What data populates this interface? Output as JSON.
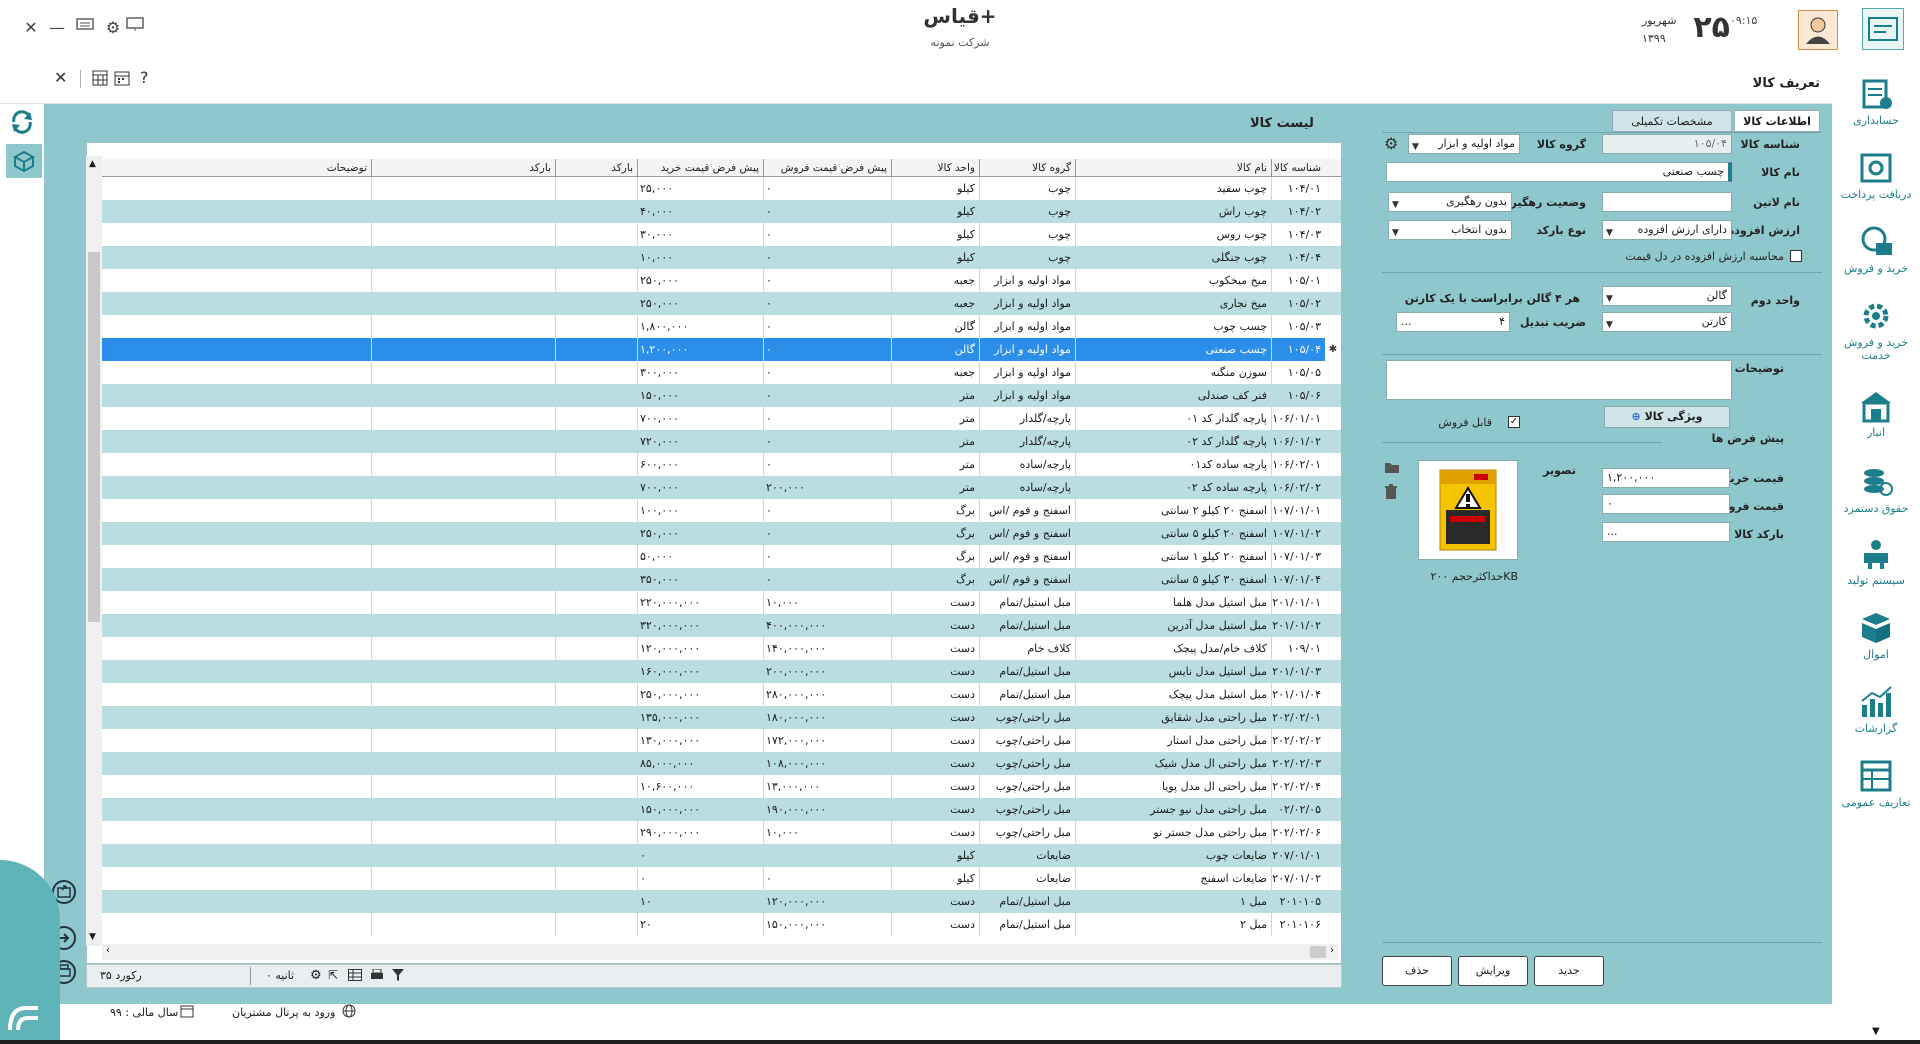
{
  "app": {
    "title": "قیاس+",
    "company": "شرکت نمونه",
    "day": "۲۵",
    "month": "شهریور",
    "year": "۱۳۹۹",
    "time": "۰۹:۱۵",
    "page_heading": "تعریف کالا"
  },
  "sidebar": [
    {
      "label": "حسابداری",
      "icon": "accounting-icon"
    },
    {
      "label": "دریافت پرداخت",
      "icon": "payment-icon"
    },
    {
      "label": "خرید و فروش",
      "icon": "trade-icon"
    },
    {
      "label": "خرید و فروش خدمت",
      "icon": "service-icon"
    },
    {
      "label": "انبار",
      "icon": "warehouse-icon"
    },
    {
      "label": "حقوق دستمزد",
      "icon": "payroll-icon"
    },
    {
      "label": "سیستم تولید",
      "icon": "production-icon"
    },
    {
      "label": "اموال",
      "icon": "assets-icon"
    },
    {
      "label": "گزارشات",
      "icon": "reports-icon"
    },
    {
      "label": "تعاریف عمومی",
      "icon": "definitions-icon"
    }
  ],
  "list": {
    "title": "لیست کالا",
    "columns": [
      "شناسه کالا",
      "نام کالا",
      "گروه کالا",
      "واحد کالا",
      "پیش فرض قیمت فروش",
      "پیش فرض قیمت خرید",
      "بارکد",
      "بارکد",
      "توضیحات"
    ],
    "rows": [
      [
        "۱۰۴/۰۱",
        "چوب سفید",
        "چوب",
        "کیلو",
        "۰",
        "۲۵,۰۰۰"
      ],
      [
        "۱۰۴/۰۲",
        "چوب راش",
        "چوب",
        "کیلو",
        "۰",
        "۴۰,۰۰۰"
      ],
      [
        "۱۰۴/۰۳",
        "چوب روس",
        "چوب",
        "کیلو",
        "۰",
        "۳۰,۰۰۰"
      ],
      [
        "۱۰۴/۰۴",
        "چوب جنگلی",
        "چوب",
        "کیلو",
        "۰",
        "۱۰,۰۰۰"
      ],
      [
        "۱۰۵/۰۱",
        "میخ میخکوب",
        "مواد اولیه و ابزار",
        "جعبه",
        "۰",
        "۲۵۰,۰۰۰"
      ],
      [
        "۱۰۵/۰۲",
        "میخ نجاری",
        "مواد اولیه و ابزار",
        "جعبه",
        "۰",
        "۲۵۰,۰۰۰"
      ],
      [
        "۱۰۵/۰۳",
        "چسب چوب",
        "مواد اولیه و ابزار",
        "گالن",
        "۰",
        "۱,۸۰۰,۰۰۰"
      ],
      [
        "۱۰۵/۰۴",
        "چسب صنعتی",
        "مواد اولیه و ابزار",
        "گالن",
        "۰",
        "۱,۲۰۰,۰۰۰"
      ],
      [
        "۱۰۵/۰۵",
        "سوزن منگنه",
        "مواد اولیه و ابزار",
        "جعبه",
        "۰",
        "۳۰۰,۰۰۰"
      ],
      [
        "۱۰۵/۰۶",
        "فنر کف صندلی",
        "مواد اولیه و ابزار",
        "متر",
        "۰",
        "۱۵۰,۰۰۰"
      ],
      [
        "۱۰۶/۰۱/۰۱",
        "پارچه گلدار کد ۰۱",
        "پارچه/گلدار",
        "متر",
        "۰",
        "۷۰۰,۰۰۰"
      ],
      [
        "۱۰۶/۰۱/۰۲",
        "پارچه گلدار کد ۰۲",
        "پارچه/گلدار",
        "متر",
        "۰",
        "۷۲۰,۰۰۰"
      ],
      [
        "۱۰۶/۰۲/۰۱",
        "پارچه ساده کد۰۱",
        "پارچه/ساده",
        "متر",
        "۰",
        "۶۰۰,۰۰۰"
      ],
      [
        "۱۰۶/۰۲/۰۲",
        "پارچه ساده کد ۰۲",
        "پارچه/ساده",
        "متر",
        "۲۰۰,۰۰۰",
        "۷۰۰,۰۰۰"
      ],
      [
        "۱۰۷/۰۱/۰۱",
        "اسفنج ۲۰ کیلو ۲ سانتی",
        "اسفنج و فوم /اس",
        "برگ",
        "۰",
        "۱۰۰,۰۰۰"
      ],
      [
        "۱۰۷/۰۱/۰۲",
        "اسفنج ۲۰ کیلو ۵ سانتی",
        "اسفنج و فوم /اس",
        "برگ",
        "۰",
        "۲۵۰,۰۰۰"
      ],
      [
        "۱۰۷/۰۱/۰۳",
        "اسفنج ۲۰ کیلو ۱ سانتی",
        "اسفنج و فوم /اس",
        "برگ",
        "۰",
        "۵۰,۰۰۰"
      ],
      [
        "۱۰۷/۰۱/۰۴",
        "اسفنج ۳۰ کیلو ۵ سانتی",
        "اسفنج و فوم /اس",
        "برگ",
        "۰",
        "۳۵۰,۰۰۰"
      ],
      [
        "۲۰۱/۰۱/۰۱",
        "مبل استیل مدل هلما",
        "مبل استیل/تمام",
        "دست",
        "۱۰,۰۰۰",
        "۲۲۰,۰۰۰,۰۰۰"
      ],
      [
        "۲۰۱/۰۱/۰۲",
        "مبل استیل مدل آدرین",
        "مبل استیل/تمام",
        "دست",
        "۴۰۰,۰۰۰,۰۰۰",
        "۳۲۰,۰۰۰,۰۰۰"
      ],
      [
        "۱۰۹/۰۱",
        "کلاف خام/مدل پیچک",
        "کلاف خام",
        "دست",
        "۱۴۰,۰۰۰,۰۰۰",
        "۱۲۰,۰۰۰,۰۰۰"
      ],
      [
        "۲۰۱/۰۱/۰۳",
        "مبل استیل مدل نایس",
        "مبل استیل/تمام",
        "دست",
        "۲۰۰,۰۰۰,۰۰۰",
        "۱۶۰,۰۰۰,۰۰۰"
      ],
      [
        "۲۰۱/۰۱/۰۴",
        "مبل استیل مدل پیچک",
        "مبل استیل/تمام",
        "دست",
        "۲۸۰,۰۰۰,۰۰۰",
        "۲۵۰,۰۰۰,۰۰۰"
      ],
      [
        "۲۰۲/۰۲/۰۱",
        "مبل راحتی مدل شقایق",
        "مبل راحتی/چوب",
        "دست",
        "۱۸۰,۰۰۰,۰۰۰",
        "۱۳۵,۰۰۰,۰۰۰"
      ],
      [
        "۲۰۲/۰۲/۰۲",
        "مبل راحتی مدل استار",
        "مبل راحتی/چوب",
        "دست",
        "۱۷۲,۰۰۰,۰۰۰",
        "۱۳۰,۰۰۰,۰۰۰"
      ],
      [
        "۲۰۲/۰۲/۰۳",
        "مبل راحتی ال مدل شیک",
        "مبل راحتی/چوب",
        "دست",
        "۱۰۸,۰۰۰,۰۰۰",
        "۸۵,۰۰۰,۰۰۰"
      ],
      [
        "۲۰۲/۰۲/۰۴",
        "مبل راحتی ال مدل پویا",
        "مبل راحتی/چوب",
        "دست",
        "۱۳,۰۰۰,۰۰۰",
        "۱۰,۶۰۰,۰۰۰"
      ],
      [
        "۰۲/۰۲/۰۵",
        "مبل راحتی مدل نیو جستر",
        "مبل راحتی/چوب",
        "دست",
        "۱۹۰,۰۰۰,۰۰۰",
        "۱۵۰,۰۰۰,۰۰۰"
      ],
      [
        "۲۰۲/۰۲/۰۶",
        "مبل راحتی مدل جستر نو",
        "مبل راحتی/چوب",
        "دست",
        "۱۰,۰۰۰",
        "۲۹۰,۰۰۰,۰۰۰"
      ],
      [
        "۲۰۷/۰۱/۰۱",
        "ضایعات چوب",
        "ضایعات",
        "کیلو",
        "",
        "۰"
      ],
      [
        "۲۰۷/۰۱/۰۲",
        "ضایعات اسفنج",
        "ضایعات",
        "کیلو",
        "۰",
        "۰"
      ],
      [
        "۲۰۱۰۱۰۵",
        "مبل ۱",
        "مبل استیل/تمام",
        "دست",
        "۱۲۰,۰۰۰,۰۰۰",
        "۱۰"
      ],
      [
        "۲۰۱۰۱۰۶",
        "مبل ۲",
        "مبل استیل/تمام",
        "دست",
        "۱۵۰,۰۰۰,۰۰۰",
        "۲۰"
      ]
    ],
    "selected_index": 7,
    "record_count": "۳۵ رکورد",
    "seconds": "۰ ثانیه"
  },
  "form": {
    "tabs": [
      "اطلاعات کالا",
      "مشخصات تکمیلی"
    ],
    "labels": {
      "code": "شناسه کالا",
      "group": "گروه کالا",
      "name": "نام کالا",
      "latin_name": "نام لاتین",
      "tracking": "وضعیت رهگیری",
      "vat": "ارزش افزوده",
      "barcode_type": "نوع بارکد",
      "vat_in_price": "محاسبه ارزش افزوده در دل قیمت",
      "second_unit": "واحد دوم",
      "conversion_note": "هر ۴ گالن برابراست با یک کارتن",
      "conversion_factor": "ضریب تبدیل",
      "description": "توضیحات",
      "features": "ویژگی کالا",
      "sellable": "قابل فروش",
      "defaults": "پیش فرض ها",
      "buy_price": "قیمت خرید",
      "sell_price": "قیمت فروش",
      "product_barcode": "بارکد کالا (۰)",
      "image": "تصویر",
      "max_size": "حداکثرحجم ۲۰۰KB"
    },
    "values": {
      "code": "۱۰۵/۰۴",
      "group": "مواد اولیه و ابزار",
      "name": "چسب صنعتی",
      "latin_name": "",
      "tracking": "بدون رهگیری",
      "vat": "دارای ارزش افزوده",
      "barcode_type": "بدون انتخاب",
      "second_unit": "گالن",
      "carton": "کارتن",
      "conversion_factor": "۴",
      "ellipsis": "...",
      "buy_price": "۱,۲۰۰,۰۰۰",
      "sell_price": "۰",
      "product_barcode": "..."
    },
    "buttons": {
      "new": "جدید",
      "edit": "ویرایش",
      "delete": "حذف"
    }
  },
  "footer": {
    "fiscal_year": "سال مالی : ۹۹",
    "portal": "ورود به پرتال مشتریان"
  },
  "colors": {
    "panel": "#8fc8cc",
    "accent": "#1c7d8c",
    "selected_row": "#2b8ee8"
  }
}
